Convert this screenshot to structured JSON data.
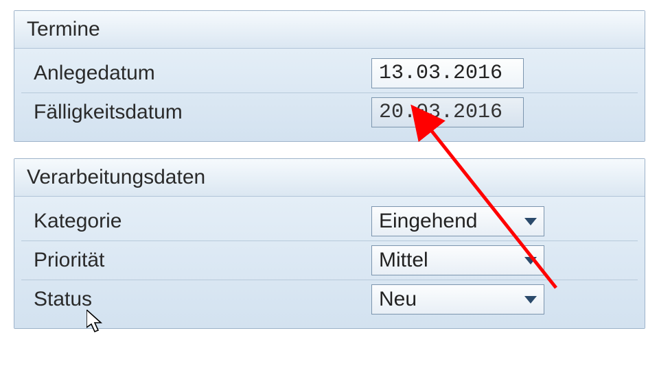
{
  "groups": {
    "termine": {
      "title": "Termine",
      "anlegedatum_label": "Anlegedatum",
      "anlegedatum_value": "13.03.2016",
      "faelligkeitsdatum_label": "Fälligkeitsdatum",
      "faelligkeitsdatum_value": "20.03.2016"
    },
    "verarbeitungsdaten": {
      "title": "Verarbeitungsdaten",
      "kategorie_label": "Kategorie",
      "kategorie_value": "Eingehend",
      "prioritaet_label": "Priorität",
      "prioritaet_value": "Mittel",
      "status_label": "Status",
      "status_value": "Neu"
    }
  },
  "annotation": {
    "arrow_color": "#ff0000"
  }
}
